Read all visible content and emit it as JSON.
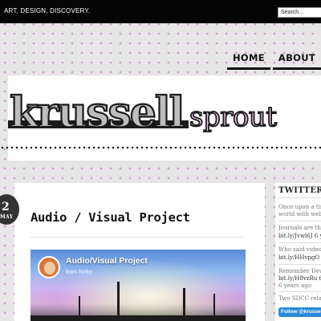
{
  "header": {
    "tagline": "ART, DESIGN, DISCOVERY.",
    "search_placeholder": "Search..."
  },
  "nav": {
    "items": [
      "HOME",
      "ABOUT"
    ]
  },
  "logo": {
    "part1": "krussell",
    "part2": "sprout"
  },
  "post": {
    "date_day": "2",
    "date_month": "MAY",
    "title": "Audio / Visual Project"
  },
  "video": {
    "title": "Audio/Visual Project",
    "from_label": "from",
    "author": "forky"
  },
  "sidebar": {
    "heading": "TWITTER",
    "tweets": [
      {
        "text": [
          "Once upon a tin",
          "world with webs"
        ],
        "link": ""
      },
      {
        "text": [
          "Journals are the"
        ],
        "link": "bit.ly/Jvwl6J 6 y"
      },
      {
        "text": [
          "Who said video"
        ],
        "link": "bit.ly/HHvpgO"
      },
      {
        "text": [
          "Remember Devi"
        ],
        "link": "bit.ly/H8vzRu 6",
        "extra": "6 years ago"
      },
      {
        "text": [
          "Two SDCC relat"
        ],
        "link": ""
      }
    ],
    "follow_label": "Follow @krusse"
  },
  "colors": {
    "topbar": "#050505",
    "dots": "#d79ad7",
    "follow_button": "#2a8ad8"
  }
}
